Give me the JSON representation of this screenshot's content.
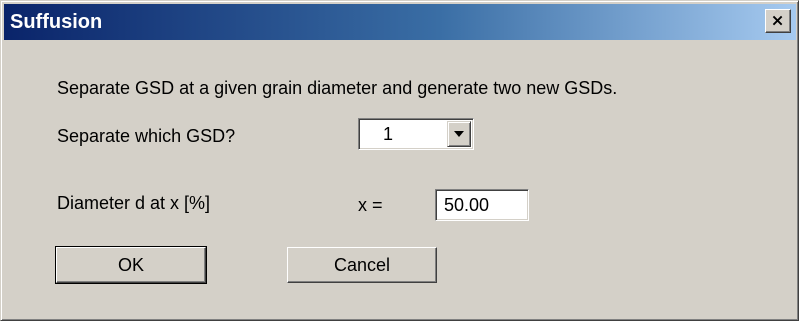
{
  "window": {
    "title": "Suffusion",
    "close_label": "close"
  },
  "dialog": {
    "description": "Separate GSD at a given grain diameter and generate two new GSDs.",
    "gsd_prompt": "Separate which GSD?",
    "gsd_selected": "1",
    "diameter_label": "Diameter d at x [%]",
    "x_label": "x =",
    "x_value": "50.00",
    "ok_label": "OK",
    "cancel_label": "Cancel"
  },
  "icons": {
    "close": "close-icon",
    "dropdown": "chevron-down-icon"
  }
}
